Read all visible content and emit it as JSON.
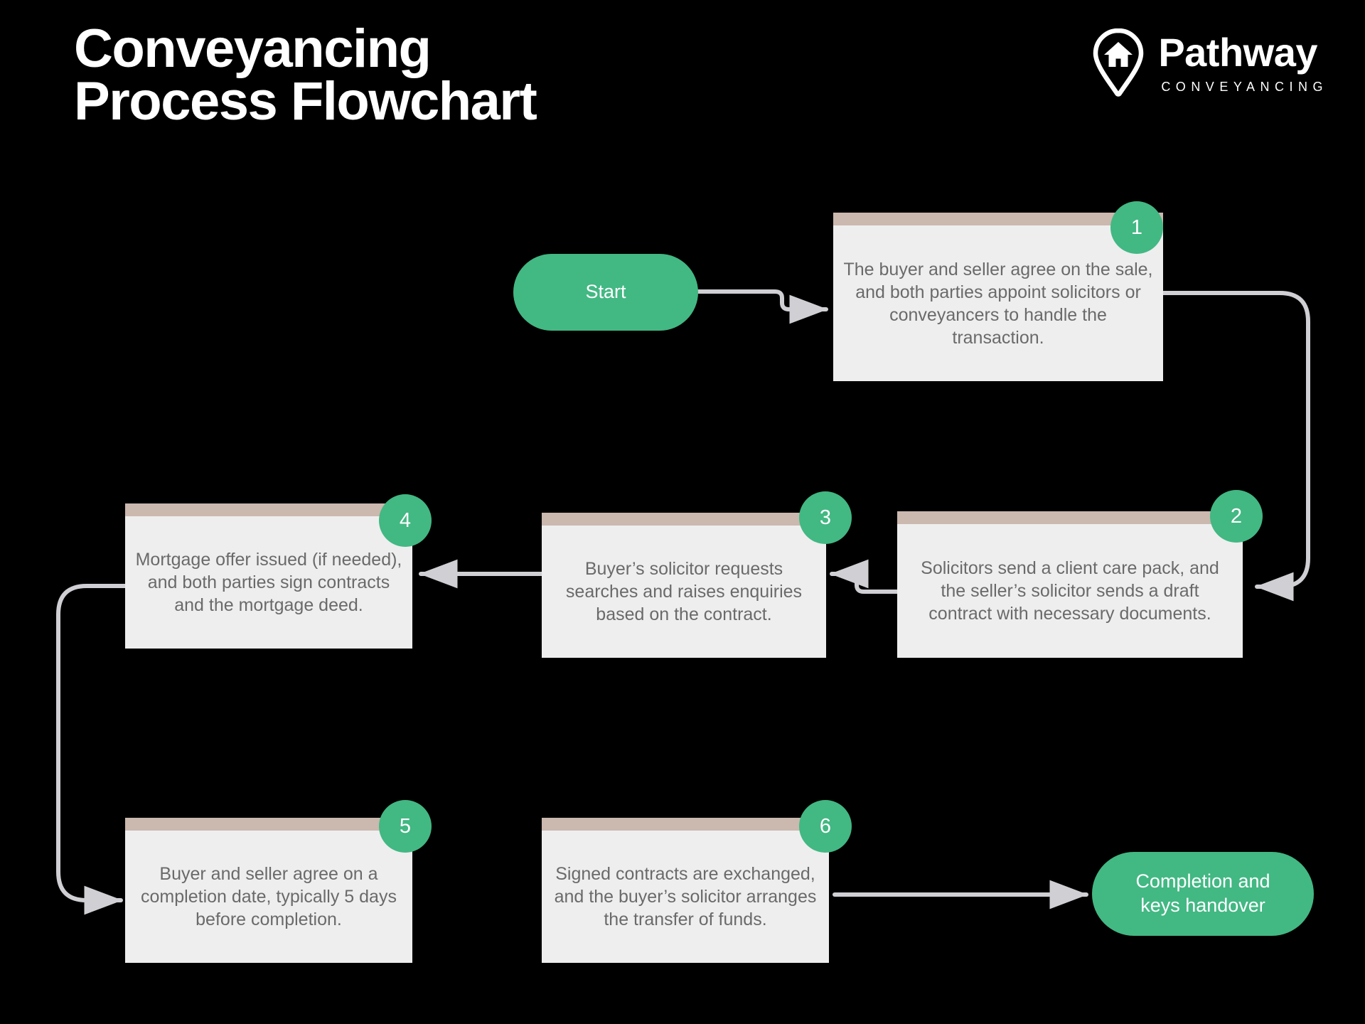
{
  "header": {
    "title": "Conveyancing\nProcess Flowchart",
    "brand_name": "Pathway",
    "brand_subtitle": "CONVEYANCING",
    "logo_icon": "map-pin-house-icon"
  },
  "theme": {
    "background": "#000000",
    "accent_green": "#42b883",
    "box_fill": "#eeeeee",
    "box_bar": "#cbb8ae",
    "box_text": "#6a6a6a",
    "connector": "#cfcfd4",
    "title_text": "#ffffff"
  },
  "flow": {
    "start_label": "Start",
    "end_label": "Completion and\nkeys handover",
    "steps": [
      {
        "number": "1",
        "text": "The buyer and seller agree on the sale, and both parties appoint solicitors or conveyancers to handle the transaction."
      },
      {
        "number": "2",
        "text": "Solicitors send a client care pack, and the seller’s solicitor sends a draft contract with necessary documents."
      },
      {
        "number": "3",
        "text": "Buyer’s solicitor requests searches and raises enquiries based on the contract."
      },
      {
        "number": "4",
        "text": "Mortgage offer issued (if needed), and both parties sign contracts and the mortgage deed."
      },
      {
        "number": "5",
        "text": "Buyer and seller agree on a completion date, typically 5 days before completion."
      },
      {
        "number": "6",
        "text": "Signed contracts are exchanged, and the buyer’s solicitor arranges the transfer of funds."
      }
    ],
    "connections": [
      "start-to-1",
      "1-to-2",
      "2-to-3",
      "3-to-4",
      "4-to-5",
      "6-to-end"
    ]
  }
}
